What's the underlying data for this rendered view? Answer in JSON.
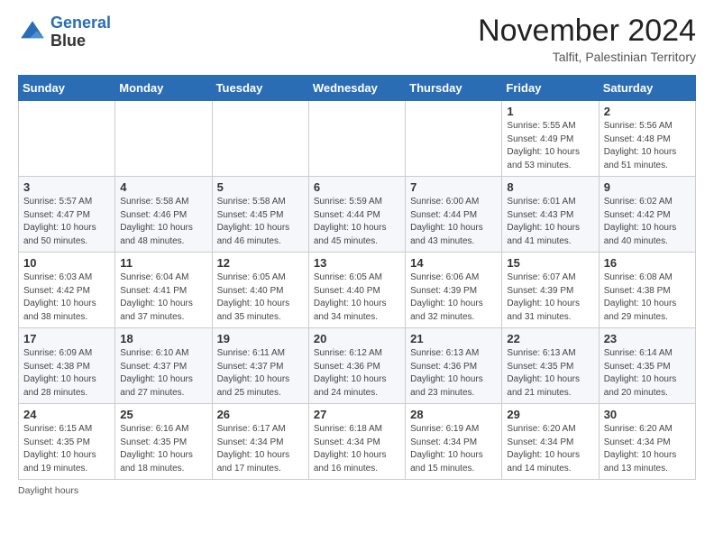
{
  "header": {
    "logo_line1": "General",
    "logo_line2": "Blue",
    "month": "November 2024",
    "location": "Talfit, Palestinian Territory"
  },
  "weekdays": [
    "Sunday",
    "Monday",
    "Tuesday",
    "Wednesday",
    "Thursday",
    "Friday",
    "Saturday"
  ],
  "weeks": [
    [
      {
        "day": "",
        "info": ""
      },
      {
        "day": "",
        "info": ""
      },
      {
        "day": "",
        "info": ""
      },
      {
        "day": "",
        "info": ""
      },
      {
        "day": "",
        "info": ""
      },
      {
        "day": "1",
        "info": "Sunrise: 5:55 AM\nSunset: 4:49 PM\nDaylight: 10 hours\nand 53 minutes."
      },
      {
        "day": "2",
        "info": "Sunrise: 5:56 AM\nSunset: 4:48 PM\nDaylight: 10 hours\nand 51 minutes."
      }
    ],
    [
      {
        "day": "3",
        "info": "Sunrise: 5:57 AM\nSunset: 4:47 PM\nDaylight: 10 hours\nand 50 minutes."
      },
      {
        "day": "4",
        "info": "Sunrise: 5:58 AM\nSunset: 4:46 PM\nDaylight: 10 hours\nand 48 minutes."
      },
      {
        "day": "5",
        "info": "Sunrise: 5:58 AM\nSunset: 4:45 PM\nDaylight: 10 hours\nand 46 minutes."
      },
      {
        "day": "6",
        "info": "Sunrise: 5:59 AM\nSunset: 4:44 PM\nDaylight: 10 hours\nand 45 minutes."
      },
      {
        "day": "7",
        "info": "Sunrise: 6:00 AM\nSunset: 4:44 PM\nDaylight: 10 hours\nand 43 minutes."
      },
      {
        "day": "8",
        "info": "Sunrise: 6:01 AM\nSunset: 4:43 PM\nDaylight: 10 hours\nand 41 minutes."
      },
      {
        "day": "9",
        "info": "Sunrise: 6:02 AM\nSunset: 4:42 PM\nDaylight: 10 hours\nand 40 minutes."
      }
    ],
    [
      {
        "day": "10",
        "info": "Sunrise: 6:03 AM\nSunset: 4:42 PM\nDaylight: 10 hours\nand 38 minutes."
      },
      {
        "day": "11",
        "info": "Sunrise: 6:04 AM\nSunset: 4:41 PM\nDaylight: 10 hours\nand 37 minutes."
      },
      {
        "day": "12",
        "info": "Sunrise: 6:05 AM\nSunset: 4:40 PM\nDaylight: 10 hours\nand 35 minutes."
      },
      {
        "day": "13",
        "info": "Sunrise: 6:05 AM\nSunset: 4:40 PM\nDaylight: 10 hours\nand 34 minutes."
      },
      {
        "day": "14",
        "info": "Sunrise: 6:06 AM\nSunset: 4:39 PM\nDaylight: 10 hours\nand 32 minutes."
      },
      {
        "day": "15",
        "info": "Sunrise: 6:07 AM\nSunset: 4:39 PM\nDaylight: 10 hours\nand 31 minutes."
      },
      {
        "day": "16",
        "info": "Sunrise: 6:08 AM\nSunset: 4:38 PM\nDaylight: 10 hours\nand 29 minutes."
      }
    ],
    [
      {
        "day": "17",
        "info": "Sunrise: 6:09 AM\nSunset: 4:38 PM\nDaylight: 10 hours\nand 28 minutes."
      },
      {
        "day": "18",
        "info": "Sunrise: 6:10 AM\nSunset: 4:37 PM\nDaylight: 10 hours\nand 27 minutes."
      },
      {
        "day": "19",
        "info": "Sunrise: 6:11 AM\nSunset: 4:37 PM\nDaylight: 10 hours\nand 25 minutes."
      },
      {
        "day": "20",
        "info": "Sunrise: 6:12 AM\nSunset: 4:36 PM\nDaylight: 10 hours\nand 24 minutes."
      },
      {
        "day": "21",
        "info": "Sunrise: 6:13 AM\nSunset: 4:36 PM\nDaylight: 10 hours\nand 23 minutes."
      },
      {
        "day": "22",
        "info": "Sunrise: 6:13 AM\nSunset: 4:35 PM\nDaylight: 10 hours\nand 21 minutes."
      },
      {
        "day": "23",
        "info": "Sunrise: 6:14 AM\nSunset: 4:35 PM\nDaylight: 10 hours\nand 20 minutes."
      }
    ],
    [
      {
        "day": "24",
        "info": "Sunrise: 6:15 AM\nSunset: 4:35 PM\nDaylight: 10 hours\nand 19 minutes."
      },
      {
        "day": "25",
        "info": "Sunrise: 6:16 AM\nSunset: 4:35 PM\nDaylight: 10 hours\nand 18 minutes."
      },
      {
        "day": "26",
        "info": "Sunrise: 6:17 AM\nSunset: 4:34 PM\nDaylight: 10 hours\nand 17 minutes."
      },
      {
        "day": "27",
        "info": "Sunrise: 6:18 AM\nSunset: 4:34 PM\nDaylight: 10 hours\nand 16 minutes."
      },
      {
        "day": "28",
        "info": "Sunrise: 6:19 AM\nSunset: 4:34 PM\nDaylight: 10 hours\nand 15 minutes."
      },
      {
        "day": "29",
        "info": "Sunrise: 6:20 AM\nSunset: 4:34 PM\nDaylight: 10 hours\nand 14 minutes."
      },
      {
        "day": "30",
        "info": "Sunrise: 6:20 AM\nSunset: 4:34 PM\nDaylight: 10 hours\nand 13 minutes."
      }
    ]
  ],
  "footer": {
    "note": "Daylight hours"
  }
}
